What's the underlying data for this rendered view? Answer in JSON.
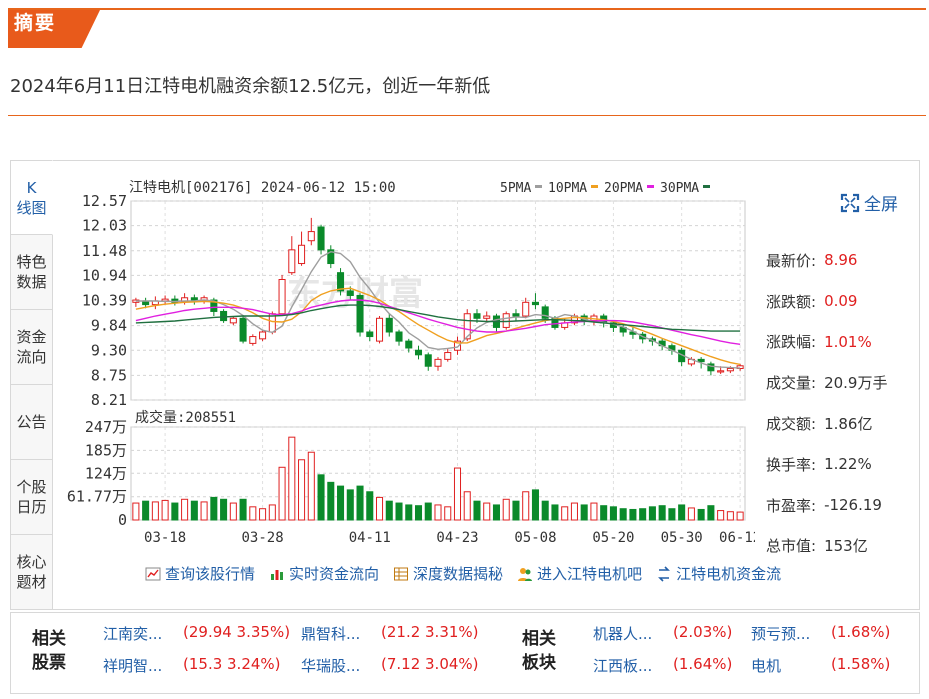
{
  "summary": {
    "tag": "摘要",
    "headline": "2024年6月11日江特电机融资余额12.5亿元，创近一年新低"
  },
  "tabs": [
    "K\n线图",
    "特色\n数据",
    "资金\n流向",
    "公告",
    "个股\n日历",
    "核心\n题材"
  ],
  "chart": {
    "title": "江特电机[002176] 2024-06-12 15:00",
    "legend": [
      {
        "label": "5PMA",
        "color": "#9e9e9e"
      },
      {
        "label": "10PMA",
        "color": "#f0a020"
      },
      {
        "label": "20PMA",
        "color": "#e020e0"
      },
      {
        "label": "30PMA",
        "color": "#207040"
      }
    ],
    "volume_label": "成交量:208551",
    "watermark": "东方财富"
  },
  "chart_data": {
    "type": "candlestick",
    "price_ticks": [
      "12.57",
      "12.03",
      "11.48",
      "10.94",
      "10.39",
      "9.84",
      "9.30",
      "8.75",
      "8.21"
    ],
    "ylim": [
      8.21,
      12.57
    ],
    "volume_ticks": [
      "247万",
      "185万",
      "124万",
      "61.77万",
      "0"
    ],
    "volume_ylim": [
      0,
      247
    ],
    "x_ticks": [
      "03-18",
      "03-28",
      "04-11",
      "04-23",
      "05-08",
      "05-20",
      "05-30",
      "06-12"
    ],
    "up_color": "#e02020",
    "down_color": "#0a8a2a",
    "candles": [
      [
        10.35,
        10.4,
        10.25,
        10.45,
        45
      ],
      [
        10.38,
        10.3,
        10.22,
        10.45,
        50
      ],
      [
        10.3,
        10.38,
        10.2,
        10.48,
        48
      ],
      [
        10.38,
        10.42,
        10.3,
        10.5,
        52
      ],
      [
        10.42,
        10.35,
        10.28,
        10.5,
        45
      ],
      [
        10.36,
        10.45,
        10.3,
        10.55,
        55
      ],
      [
        10.45,
        10.38,
        10.3,
        10.52,
        50
      ],
      [
        10.38,
        10.45,
        10.32,
        10.5,
        48
      ],
      [
        10.4,
        10.15,
        10.05,
        10.45,
        60
      ],
      [
        10.15,
        9.95,
        9.9,
        10.2,
        55
      ],
      [
        9.9,
        10.0,
        9.85,
        10.05,
        45
      ],
      [
        10.0,
        9.5,
        9.45,
        10.05,
        55
      ],
      [
        9.45,
        9.6,
        9.4,
        9.65,
        35
      ],
      [
        9.55,
        9.7,
        9.5,
        9.75,
        30
      ],
      [
        9.7,
        10.1,
        9.65,
        10.15,
        40
      ],
      [
        10.1,
        10.85,
        10.05,
        10.95,
        140
      ],
      [
        11.0,
        11.5,
        10.95,
        11.8,
        220
      ],
      [
        11.2,
        11.6,
        11.15,
        11.9,
        160
      ],
      [
        11.7,
        11.9,
        11.6,
        12.2,
        180
      ],
      [
        12.0,
        11.5,
        11.4,
        12.05,
        120
      ],
      [
        11.5,
        11.2,
        11.1,
        11.6,
        100
      ],
      [
        11.0,
        10.6,
        10.5,
        11.1,
        90
      ],
      [
        10.6,
        10.5,
        10.4,
        10.7,
        80
      ],
      [
        10.5,
        9.7,
        9.6,
        10.55,
        90
      ],
      [
        9.7,
        9.6,
        9.5,
        9.75,
        75
      ],
      [
        9.5,
        10.0,
        9.45,
        10.05,
        60
      ],
      [
        10.0,
        9.7,
        9.6,
        10.1,
        50
      ],
      [
        9.7,
        9.5,
        9.4,
        9.75,
        45
      ],
      [
        9.5,
        9.35,
        9.25,
        9.55,
        40
      ],
      [
        9.3,
        9.2,
        9.1,
        9.4,
        38
      ],
      [
        9.2,
        8.95,
        8.85,
        9.25,
        45
      ],
      [
        8.95,
        9.1,
        8.85,
        9.15,
        40
      ],
      [
        9.1,
        9.25,
        9.05,
        9.35,
        35
      ],
      [
        9.3,
        9.5,
        9.2,
        9.6,
        138
      ],
      [
        9.55,
        10.1,
        9.5,
        10.2,
        75
      ],
      [
        10.1,
        10.0,
        9.9,
        10.2,
        50
      ],
      [
        10.0,
        10.05,
        9.9,
        10.15,
        45
      ],
      [
        10.05,
        9.8,
        9.7,
        10.1,
        40
      ],
      [
        9.8,
        10.1,
        9.75,
        10.15,
        55
      ],
      [
        10.1,
        10.05,
        9.95,
        10.2,
        50
      ],
      [
        10.05,
        10.35,
        10.0,
        10.45,
        75
      ],
      [
        10.35,
        10.3,
        10.2,
        10.55,
        80
      ],
      [
        10.25,
        10.0,
        9.9,
        10.3,
        50
      ],
      [
        10.0,
        9.8,
        9.75,
        10.05,
        40
      ],
      [
        9.8,
        9.9,
        9.75,
        10.0,
        35
      ],
      [
        9.9,
        10.05,
        9.85,
        10.1,
        45
      ],
      [
        10.05,
        9.95,
        9.85,
        10.1,
        40
      ],
      [
        9.95,
        10.05,
        9.85,
        10.1,
        45
      ],
      [
        10.05,
        9.9,
        9.8,
        10.1,
        38
      ],
      [
        9.9,
        9.8,
        9.7,
        9.95,
        35
      ],
      [
        9.8,
        9.7,
        9.6,
        9.85,
        30
      ],
      [
        9.7,
        9.65,
        9.55,
        9.8,
        28
      ],
      [
        9.65,
        9.55,
        9.45,
        9.7,
        30
      ],
      [
        9.55,
        9.5,
        9.4,
        9.6,
        35
      ],
      [
        9.5,
        9.4,
        9.3,
        9.55,
        38
      ],
      [
        9.4,
        9.3,
        9.2,
        9.45,
        30
      ],
      [
        9.3,
        9.05,
        8.95,
        9.35,
        40
      ],
      [
        9.0,
        9.1,
        8.95,
        9.15,
        32
      ],
      [
        9.1,
        9.05,
        8.9,
        9.15,
        28
      ],
      [
        9.0,
        8.85,
        8.75,
        9.05,
        38
      ],
      [
        8.85,
        8.85,
        8.78,
        8.95,
        25
      ],
      [
        8.85,
        8.9,
        8.8,
        8.95,
        22
      ],
      [
        8.9,
        8.96,
        8.85,
        9.0,
        21
      ]
    ],
    "ma": {
      "5PMA": [
        10.38,
        10.38,
        10.38,
        10.37,
        10.37,
        10.38,
        10.38,
        10.4,
        10.38,
        10.3,
        10.2,
        10.06,
        9.88,
        9.74,
        9.69,
        9.83,
        10.25,
        10.63,
        11.02,
        11.34,
        11.46,
        11.42,
        11.24,
        10.9,
        10.64,
        10.34,
        10.1,
        9.92,
        9.68,
        9.54,
        9.36,
        9.32,
        9.34,
        9.37,
        9.6,
        9.79,
        9.91,
        9.97,
        10.0,
        10.03,
        10.02,
        10.08,
        10.06,
        10.0,
        10.08,
        10.05,
        9.98,
        9.93,
        9.91,
        9.87,
        9.81,
        9.72,
        9.6,
        9.52,
        9.4,
        9.3,
        9.2,
        9.1,
        9.02,
        8.95,
        8.93,
        8.92,
        8.91
      ],
      "10PMA": [
        10.2,
        10.24,
        10.28,
        10.31,
        10.33,
        10.35,
        10.36,
        10.37,
        10.36,
        10.33,
        10.29,
        10.22,
        10.12,
        10.0,
        9.93,
        9.92,
        9.98,
        10.14,
        10.39,
        10.52,
        10.6,
        10.64,
        10.66,
        10.58,
        10.5,
        10.4,
        10.26,
        10.15,
        10.0,
        9.86,
        9.74,
        9.62,
        9.52,
        9.46,
        9.46,
        9.54,
        9.62,
        9.67,
        9.72,
        9.78,
        9.84,
        9.9,
        9.95,
        9.98,
        10.0,
        10.02,
        10.01,
        9.99,
        9.97,
        9.93,
        9.88,
        9.81,
        9.73,
        9.65,
        9.56,
        9.48,
        9.4,
        9.32,
        9.24,
        9.16,
        9.09,
        9.03,
        8.99
      ],
      "20PMA": [
        9.95,
        10.0,
        10.05,
        10.09,
        10.13,
        10.17,
        10.2,
        10.22,
        10.24,
        10.24,
        10.24,
        10.22,
        10.19,
        10.14,
        10.09,
        10.08,
        10.1,
        10.16,
        10.24,
        10.29,
        10.34,
        10.38,
        10.4,
        10.4,
        10.38,
        10.33,
        10.26,
        10.19,
        10.12,
        10.05,
        9.98,
        9.92,
        9.86,
        9.8,
        9.76,
        9.72,
        9.7,
        9.7,
        9.72,
        9.75,
        9.78,
        9.82,
        9.86,
        9.88,
        9.9,
        9.92,
        9.93,
        9.94,
        9.95,
        9.95,
        9.94,
        9.92,
        9.88,
        9.84,
        9.79,
        9.74,
        9.69,
        9.64,
        9.6,
        9.55,
        9.5,
        9.46,
        9.43
      ],
      "30PMA": [
        9.9,
        9.91,
        9.92,
        9.93,
        9.94,
        9.96,
        9.98,
        10.0,
        10.02,
        10.03,
        10.04,
        10.05,
        10.05,
        10.05,
        10.05,
        10.06,
        10.08,
        10.12,
        10.17,
        10.21,
        10.25,
        10.28,
        10.29,
        10.29,
        10.28,
        10.26,
        10.23,
        10.19,
        10.15,
        10.11,
        10.07,
        10.03,
        10.0,
        9.97,
        9.95,
        9.94,
        9.93,
        9.93,
        9.93,
        9.94,
        9.95,
        9.96,
        9.97,
        9.97,
        9.96,
        9.95,
        9.94,
        9.92,
        9.9,
        9.88,
        9.86,
        9.84,
        9.82,
        9.8,
        9.78,
        9.76,
        9.75,
        9.74,
        9.73,
        9.72,
        9.72,
        9.72,
        9.72
      ]
    }
  },
  "fullscreen_label": "全屏",
  "stats": [
    {
      "k": "最新价:",
      "v": "8.96",
      "red": true
    },
    {
      "k": "涨跌额:",
      "v": "0.09",
      "red": true
    },
    {
      "k": "涨跌幅:",
      "v": "1.01%",
      "red": true
    },
    {
      "k": "成交量:",
      "v": "20.9万手",
      "red": false
    },
    {
      "k": "成交额:",
      "v": "1.86亿",
      "red": false
    },
    {
      "k": "换手率:",
      "v": "1.22%",
      "red": false
    },
    {
      "k": "市盈率:",
      "v": "-126.19",
      "red": false
    },
    {
      "k": "总市值:",
      "v": "153亿",
      "red": false
    }
  ],
  "links": [
    {
      "label": "查询该股行情",
      "icon": "line-chart-icon"
    },
    {
      "label": "实时资金流向",
      "icon": "bar-chart-icon"
    },
    {
      "label": "深度数据揭秘",
      "icon": "table-icon"
    },
    {
      "label": "进入江特电机吧",
      "icon": "people-icon"
    },
    {
      "label": "江特电机资金流",
      "icon": "flow-icon"
    }
  ],
  "related_stocks": {
    "heading": "相关\n股票",
    "items": [
      {
        "name": "江南奕...",
        "val": "(29.94 3.35%)"
      },
      {
        "name": "鼎智科...",
        "val": "(21.2 3.31%)"
      },
      {
        "name": "祥明智...",
        "val": "(15.3 3.24%)"
      },
      {
        "name": "华瑞股...",
        "val": "(7.12 3.04%)"
      }
    ]
  },
  "related_sectors": {
    "heading": "相关\n板块",
    "items": [
      {
        "name": "机器人...",
        "val": "(2.03%)"
      },
      {
        "name": "预亏预...",
        "val": "(1.68%)"
      },
      {
        "name": "江西板...",
        "val": "(1.64%)"
      },
      {
        "name": "电机",
        "val": "(1.58%)"
      }
    ]
  }
}
